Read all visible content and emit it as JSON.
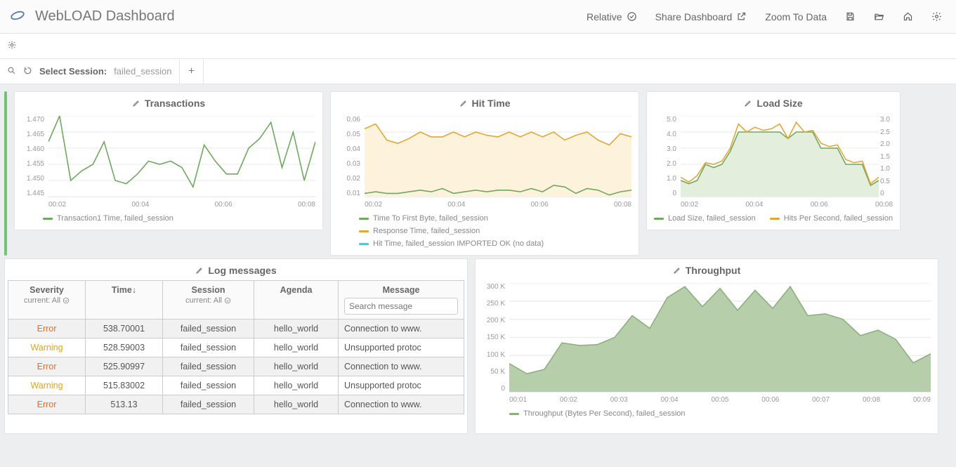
{
  "header": {
    "title": "WebLOAD Dashboard",
    "relative": "Relative",
    "share": "Share Dashboard",
    "zoom": "Zoom To Data"
  },
  "sessionbar": {
    "label": "Select Session:",
    "value": "failed_session"
  },
  "colors": {
    "green": "#6fa85f",
    "orange": "#e3a736",
    "cyan": "#5bc5d6",
    "areaGreen": "#a8c99b",
    "areaGreenFill": "#cfe1c6",
    "areaOrangeFill": "#fdf2dc"
  },
  "panels": {
    "transactions": {
      "title": "Transactions",
      "legend": [
        "Transaction1 Time, failed_session"
      ]
    },
    "hitTime": {
      "title": "Hit Time",
      "legend": [
        "Time To First Byte, failed_session",
        "Response Time, failed_session",
        "Hit Time, failed_session IMPORTED OK (no data)"
      ]
    },
    "loadSize": {
      "title": "Load Size",
      "legend": [
        "Load Size, failed_session",
        "Hits Per Second, failed_session"
      ]
    },
    "logs": {
      "title": "Log messages",
      "columns": {
        "severity": "Severity",
        "severitySub": "current: All",
        "time": "Time",
        "session": "Session",
        "sessionSub": "current: All",
        "agenda": "Agenda",
        "message": "Message",
        "placeholder": "Search message"
      },
      "rows": [
        {
          "sev": "Error",
          "sevClass": "sev-error",
          "time": "538.70001",
          "session": "failed_session",
          "agenda": "hello_world",
          "msg": "Connection to www."
        },
        {
          "sev": "Warning",
          "sevClass": "sev-warning",
          "time": "528.59003",
          "session": "failed_session",
          "agenda": "hello_world",
          "msg": "Unsupported protoc"
        },
        {
          "sev": "Error",
          "sevClass": "sev-error",
          "time": "525.90997",
          "session": "failed_session",
          "agenda": "hello_world",
          "msg": "Connection to www."
        },
        {
          "sev": "Warning",
          "sevClass": "sev-warning",
          "time": "515.83002",
          "session": "failed_session",
          "agenda": "hello_world",
          "msg": "Unsupported protoc"
        },
        {
          "sev": "Error",
          "sevClass": "sev-error",
          "time": "513.13",
          "session": "failed_session",
          "agenda": "hello_world",
          "msg": "Connection to www."
        }
      ]
    },
    "throughput": {
      "title": "Throughput",
      "legend": [
        "Throughput (Bytes Per Second), failed_session"
      ]
    }
  },
  "chart_data": [
    {
      "id": "transactions",
      "type": "line",
      "title": "Transactions",
      "x_ticks": [
        "00:02",
        "00:04",
        "00:06",
        "00:08"
      ],
      "y_ticks": [
        "1.445",
        "1.450",
        "1.455",
        "1.460",
        "1.465",
        "1.470"
      ],
      "ylim": [
        1.445,
        1.47
      ],
      "series": [
        {
          "name": "Transaction1 Time, failed_session",
          "color": "green",
          "values": [
            1.462,
            1.47,
            1.45,
            1.453,
            1.455,
            1.462,
            1.45,
            1.449,
            1.452,
            1.456,
            1.455,
            1.456,
            1.454,
            1.448,
            1.461,
            1.456,
            1.452,
            1.452,
            1.46,
            1.463,
            1.468,
            1.454,
            1.465,
            1.45,
            1.462
          ]
        }
      ]
    },
    {
      "id": "hitTime",
      "type": "line",
      "title": "Hit Time",
      "x_ticks": [
        "00:02",
        "00:04",
        "00:06",
        "00:08"
      ],
      "y_ticks": [
        "0.01",
        "0.02",
        "0.03",
        "0.04",
        "0.05",
        "0.06"
      ],
      "ylim": [
        0.01,
        0.06
      ],
      "series": [
        {
          "name": "Response Time, failed_session",
          "color": "orange",
          "fill": true,
          "values": [
            0.052,
            0.055,
            0.045,
            0.043,
            0.046,
            0.05,
            0.047,
            0.047,
            0.05,
            0.047,
            0.05,
            0.048,
            0.047,
            0.05,
            0.047,
            0.05,
            0.047,
            0.05,
            0.045,
            0.048,
            0.05,
            0.045,
            0.042,
            0.049,
            0.047
          ]
        },
        {
          "name": "Time To First Byte, failed_session",
          "color": "green",
          "values": [
            0.012,
            0.013,
            0.012,
            0.012,
            0.013,
            0.014,
            0.013,
            0.015,
            0.012,
            0.013,
            0.014,
            0.013,
            0.014,
            0.014,
            0.013,
            0.015,
            0.013,
            0.017,
            0.016,
            0.012,
            0.015,
            0.014,
            0.011,
            0.013,
            0.014
          ]
        }
      ]
    },
    {
      "id": "loadSize",
      "type": "line",
      "title": "Load Size",
      "x_ticks": [
        "00:02",
        "00:04",
        "00:06",
        "00:08"
      ],
      "y_ticks": [
        "0",
        "1.0",
        "2.0",
        "3.0",
        "4.0",
        "5.0"
      ],
      "y2_ticks": [
        "0",
        "0.5",
        "1.0",
        "1.5",
        "2.0",
        "2.5",
        "3.0"
      ],
      "ylim": [
        0,
        5.0
      ],
      "series": [
        {
          "name": "Load Size, failed_session",
          "color": "green",
          "fill": true,
          "values": [
            1.0,
            0.8,
            1.0,
            2.0,
            1.8,
            2.0,
            2.8,
            4.0,
            4.0,
            4.0,
            4.0,
            4.0,
            4.0,
            3.6,
            4.0,
            4.0,
            4.0,
            3.0,
            3.0,
            3.0,
            2.0,
            2.0,
            2.0,
            0.7,
            1.0
          ]
        },
        {
          "name": "Hits Per Second, failed_session",
          "color": "orange",
          "values": [
            1.2,
            0.9,
            1.3,
            2.1,
            2.0,
            2.2,
            3.0,
            4.5,
            4.0,
            4.3,
            4.1,
            4.2,
            4.5,
            3.6,
            4.6,
            4.0,
            4.1,
            3.3,
            3.1,
            3.2,
            2.3,
            2.1,
            2.2,
            0.8,
            1.2
          ]
        }
      ]
    },
    {
      "id": "throughput",
      "type": "area",
      "title": "Throughput",
      "x_ticks": [
        "00:01",
        "00:02",
        "00:03",
        "00:04",
        "00:05",
        "00:06",
        "00:07",
        "00:08",
        "00:09"
      ],
      "y_ticks": [
        "0",
        "50 K",
        "100 K",
        "150 K",
        "200 K",
        "250 K",
        "300 K"
      ],
      "ylim": [
        0,
        300000
      ],
      "series": [
        {
          "name": "Throughput (Bytes Per Second), failed_session",
          "color": "areaGreen",
          "fill": true,
          "values": [
            78000,
            50000,
            62000,
            135000,
            128000,
            130000,
            150000,
            210000,
            175000,
            260000,
            290000,
            235000,
            285000,
            225000,
            280000,
            230000,
            290000,
            210000,
            215000,
            200000,
            155000,
            170000,
            145000,
            80000,
            105000
          ]
        }
      ]
    }
  ]
}
